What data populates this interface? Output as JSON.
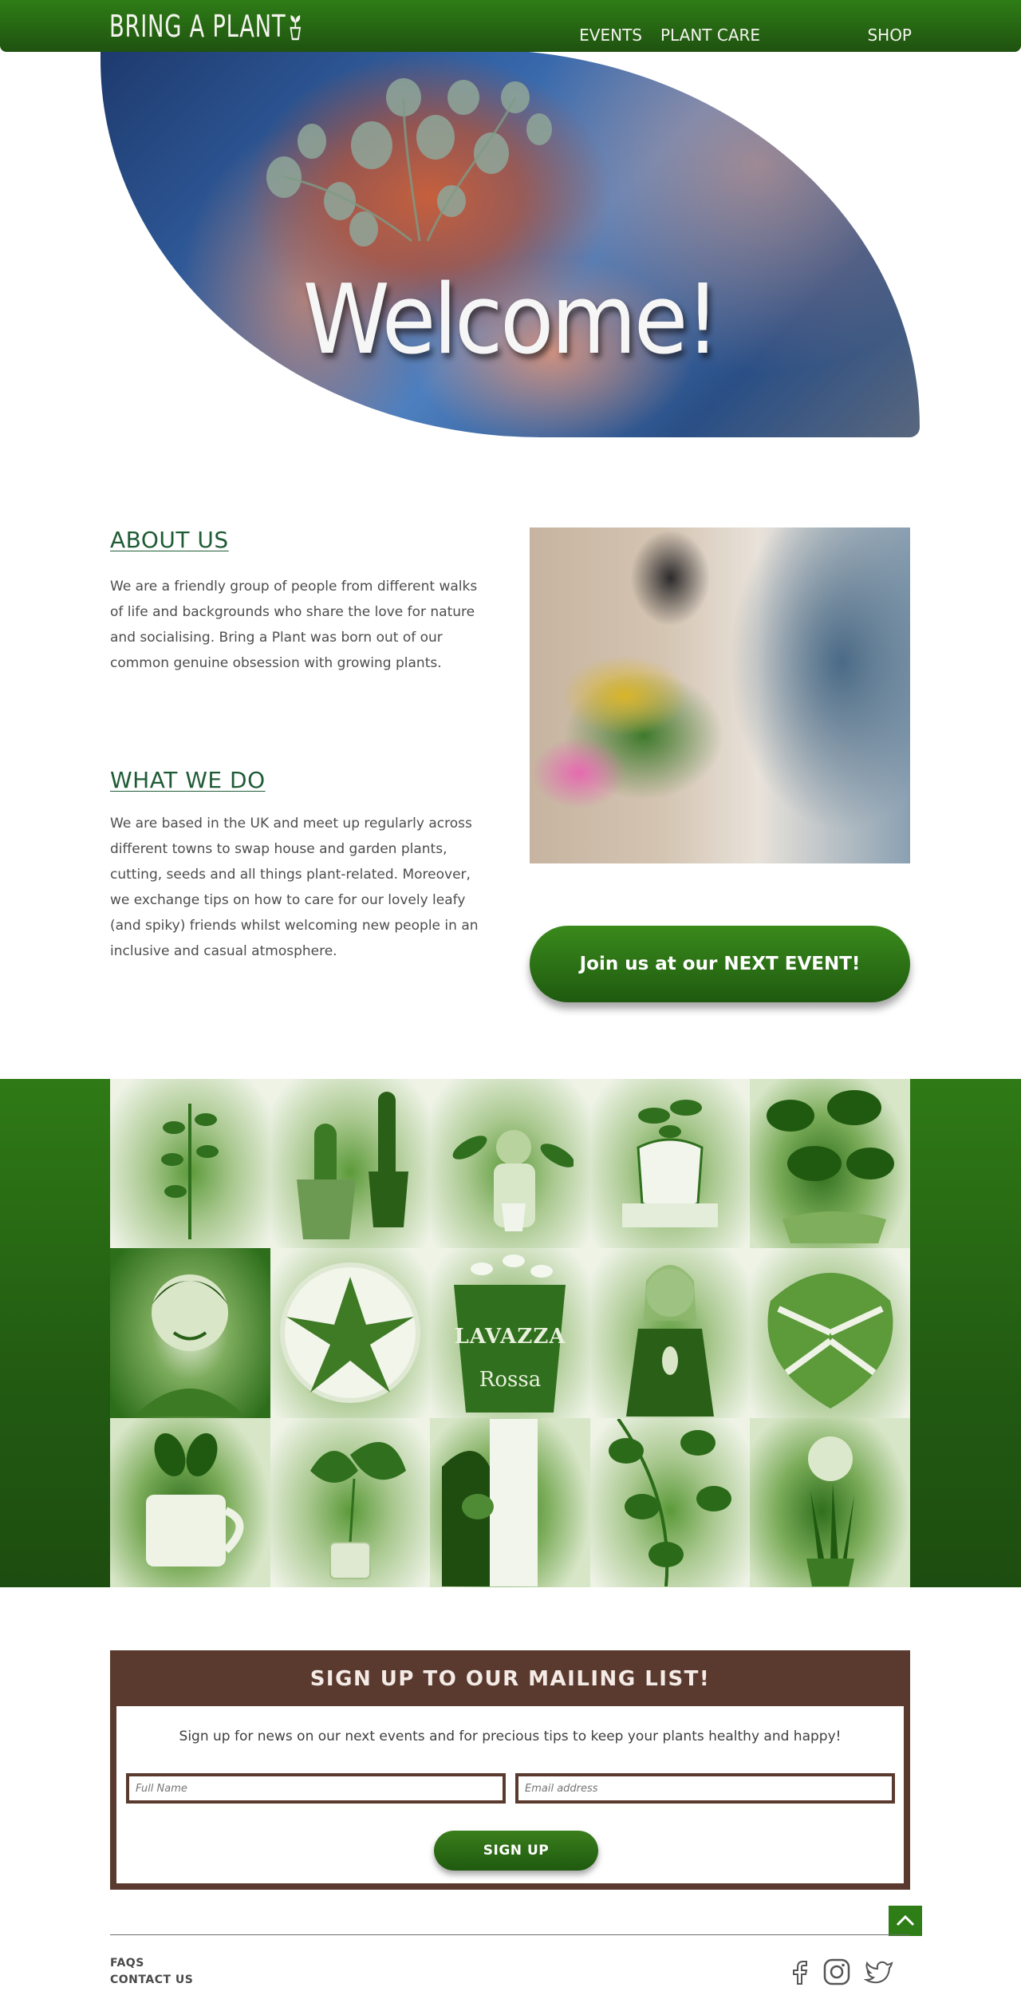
{
  "nav": {
    "logo": "BRING A PLANT",
    "links": [
      {
        "label": "EVENTS"
      },
      {
        "label": "PLANT CARE"
      },
      {
        "label": "SHOP"
      }
    ]
  },
  "hero": {
    "title": "Welcome!"
  },
  "about": {
    "heading": "ABOUT US",
    "text": "We are a friendly group of people from different walks of life and backgrounds who share the love for nature and socialising. Bring a Plant was born out of our common genuine obsession with growing plants."
  },
  "what_we_do": {
    "heading": "WHAT WE DO",
    "text": "We are based in the UK and meet up regularly across different towns to swap house and garden plants, cutting, seeds and all things plant-related. Moreover, we exchange tips on how to care for our lovely leafy (and spiky) friends whilst welcoming new people in an inclusive and casual atmosphere."
  },
  "cta": {
    "label": "Join us at our NEXT EVENT!"
  },
  "gallery": {
    "tile_8_text_main": "LAVAZZA",
    "tile_8_text_sub": "Rossa"
  },
  "mailing": {
    "title": "SIGN UP TO OUR MAILING LIST!",
    "description": "Sign up for news on our next events and for precious tips  to keep your plants  healthy and happy!",
    "name_placeholder": "Full Name",
    "email_placeholder": "Email address",
    "button_label": "SIGN UP"
  },
  "footer": {
    "links": [
      {
        "label": "FAQS"
      },
      {
        "label": "CONTACT US"
      }
    ],
    "social_icons": [
      "facebook-icon",
      "instagram-icon",
      "twitter-icon"
    ]
  },
  "colors": {
    "brand_green": "#2e7d16",
    "dark_green": "#1f5210",
    "heading_green": "#1f5c36",
    "mailing_brown": "#5a3a2e"
  }
}
